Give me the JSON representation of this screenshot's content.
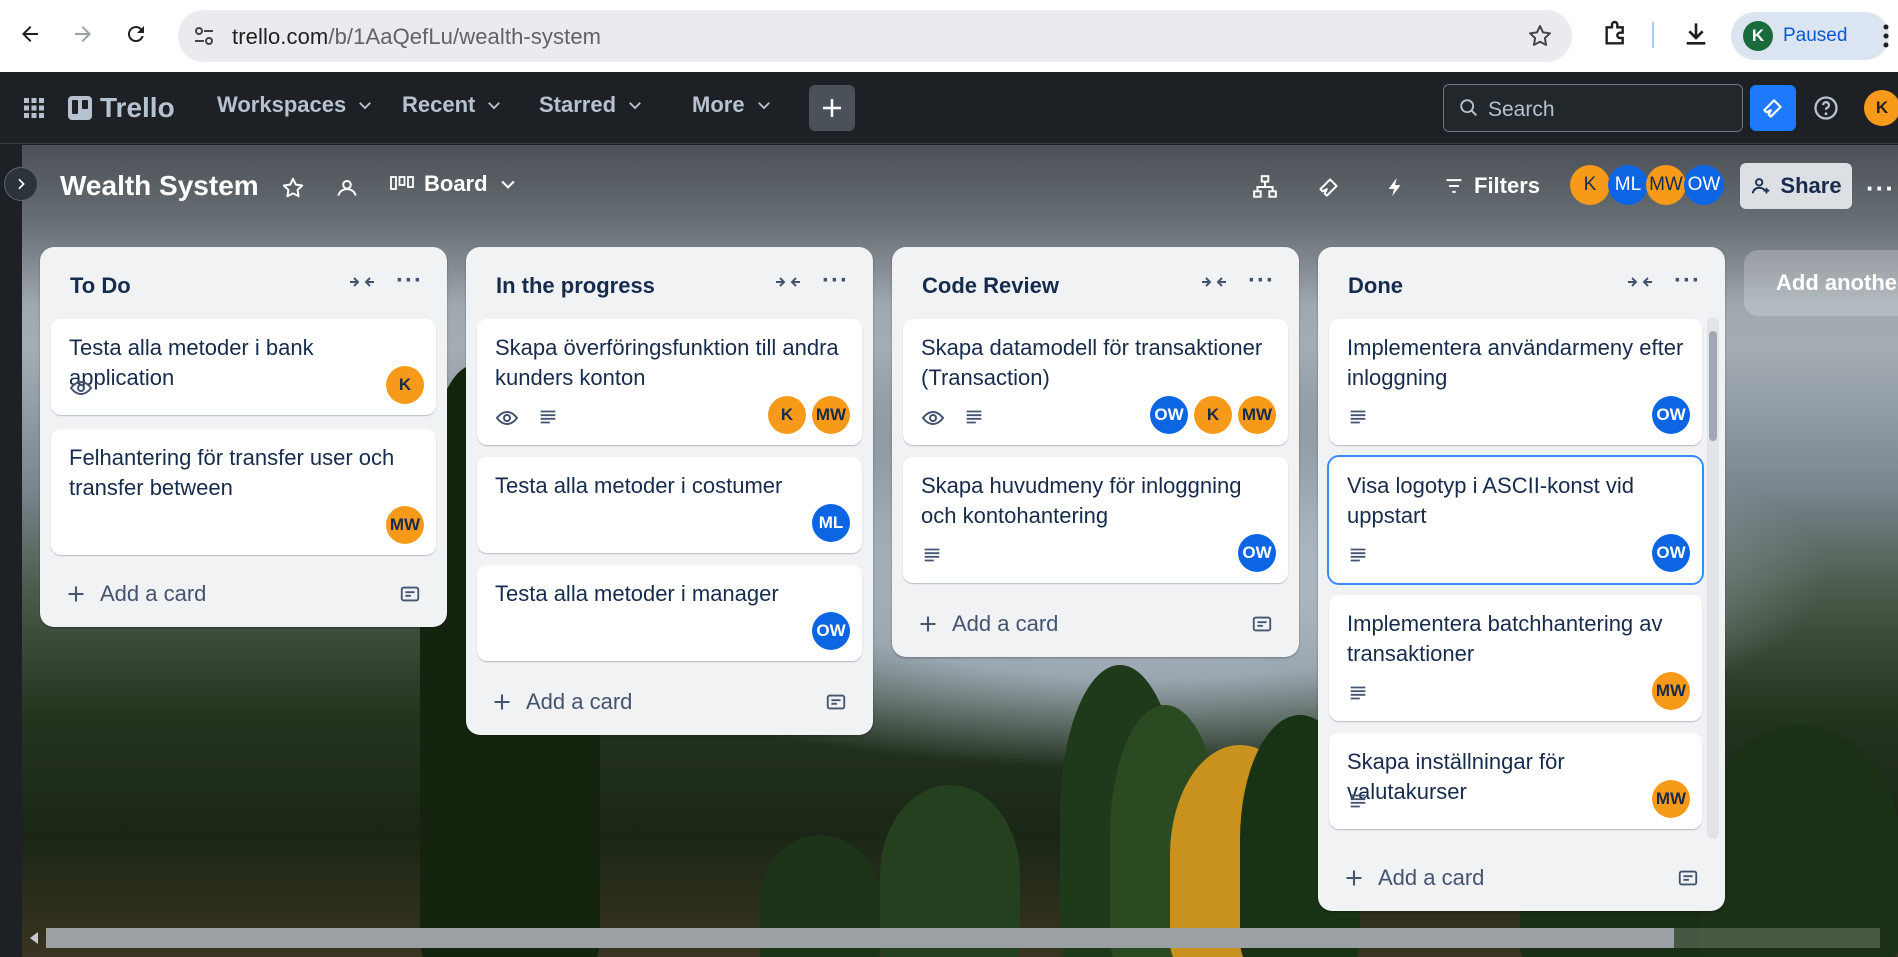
{
  "browser": {
    "url_host": "trello.com",
    "url_path": "/b/1AaQefLu/wealth-system",
    "profile_initial": "K",
    "profile_status": "Paused"
  },
  "header": {
    "logo": "Trello",
    "workspaces": "Workspaces",
    "recent": "Recent",
    "starred": "Starred",
    "more": "More",
    "search_placeholder": "Search",
    "avatar_initial": "K"
  },
  "board": {
    "title": "Wealth System",
    "view": "Board",
    "filters": "Filters",
    "share": "Share",
    "add_list": "Add another list",
    "members": [
      {
        "initials": "K",
        "color": "#f79a1a"
      },
      {
        "initials": "ML",
        "color": "#0c66e4"
      },
      {
        "initials": "MW",
        "color": "#f79a1a"
      },
      {
        "initials": "OW",
        "color": "#0c66e4"
      }
    ]
  },
  "lists": [
    {
      "title": "To Do",
      "add_card": "Add a card",
      "cards": [
        {
          "title": "Testa alla metoder i bank application",
          "badges": [
            "eye-icon"
          ],
          "members": [
            "K"
          ]
        },
        {
          "title": "Felhantering för transfer user och transfer between",
          "badges": [],
          "members": [
            "MW"
          ]
        }
      ]
    },
    {
      "title": "In the progress",
      "add_card": "Add a card",
      "cards": [
        {
          "title": "Skapa överföringsfunktion till andra kunders konton",
          "badges": [
            "eye-icon",
            "description-icon"
          ],
          "members": [
            "K",
            "MW"
          ]
        },
        {
          "title": "Testa alla metoder i costumer",
          "badges": [],
          "members": [
            "ML"
          ]
        },
        {
          "title": "Testa alla metoder i manager",
          "badges": [],
          "members": [
            "OW"
          ]
        }
      ]
    },
    {
      "title": "Code Review",
      "add_card": "Add a card",
      "cards": [
        {
          "title": "Skapa datamodell för transaktioner (Transaction)",
          "badges": [
            "eye-icon",
            "description-icon"
          ],
          "members": [
            "OW",
            "K",
            "MW"
          ]
        },
        {
          "title": "Skapa huvudmeny för inloggning och kontohantering",
          "badges": [
            "description-icon"
          ],
          "members": [
            "OW"
          ]
        }
      ]
    },
    {
      "title": "Done",
      "add_card": "Add a card",
      "cards": [
        {
          "title": "Implementera användarmeny efter inloggning",
          "badges": [
            "description-icon"
          ],
          "members": [
            "OW"
          ]
        },
        {
          "title": "Visa logotyp i ASCII-konst vid uppstart",
          "badges": [
            "description-icon"
          ],
          "members": [
            "OW"
          ]
        },
        {
          "title": "Implementera batchhantering av transaktioner",
          "badges": [
            "description-icon"
          ],
          "members": [
            "MW"
          ]
        },
        {
          "title": "Skapa inställningar för valutakurser",
          "badges": [
            "description-icon"
          ],
          "members": [
            "MW"
          ]
        }
      ]
    }
  ]
}
